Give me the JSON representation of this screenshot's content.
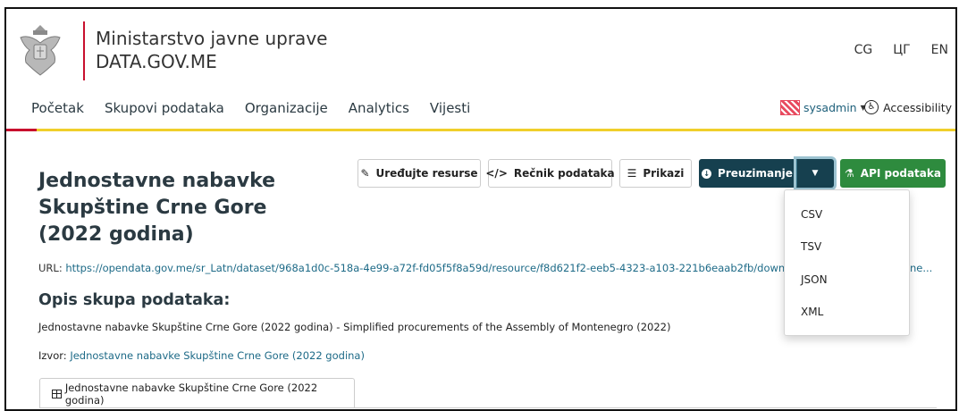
{
  "header": {
    "org_line1": "Ministarstvo javne uprave",
    "org_line2": "DATA.GOV.ME",
    "languages": [
      "CG",
      "ЦГ",
      "EN"
    ]
  },
  "nav": {
    "items": [
      "Početak",
      "Skupovi podataka",
      "Organizacije",
      "Analytics",
      "Vijesti"
    ],
    "user": "sysadmin",
    "accessibility": "Accessibility"
  },
  "resource": {
    "title": "Jednostavne nabavke Skupštine Crne Gore (2022 godina)",
    "url_label": "URL:",
    "url": "https://opendata.gov.me/sr_Latn/dataset/968a1d0c-518a-4e99-a72f-fd05f5f8a59d/resource/f8d621f2-eeb5-4323-a103-221b6eaab2fb/download/jedi",
    "url_tail": "ne...",
    "section_title": "Opis skupa podataka:",
    "description": "Jednostavne nabavke Skupštine Crne Gore (2022 godina) - Simplified procurements of the Assembly of Montenegro (2022)",
    "source_label": "Izvor:",
    "source_link": "Jednostavne nabavke Skupštine Crne Gore (2022 godina)",
    "tab_label": "Jednostavne nabavke Skupštine Crne Gore (2022 godina)"
  },
  "actions": {
    "edit": "Uređujte resurse",
    "dictionary": "Rečnik podataka",
    "views": "Prikazi",
    "download": "Preuzimanje",
    "api": "API podataka"
  },
  "download_menu": [
    "CSV",
    "TSV",
    "JSON",
    "XML"
  ],
  "colors": {
    "accent_red": "#c8102e",
    "rule_yellow": "#f0cf2b",
    "dark_teal": "#16404f",
    "green": "#2e8b3e",
    "link": "#1d6a87"
  }
}
